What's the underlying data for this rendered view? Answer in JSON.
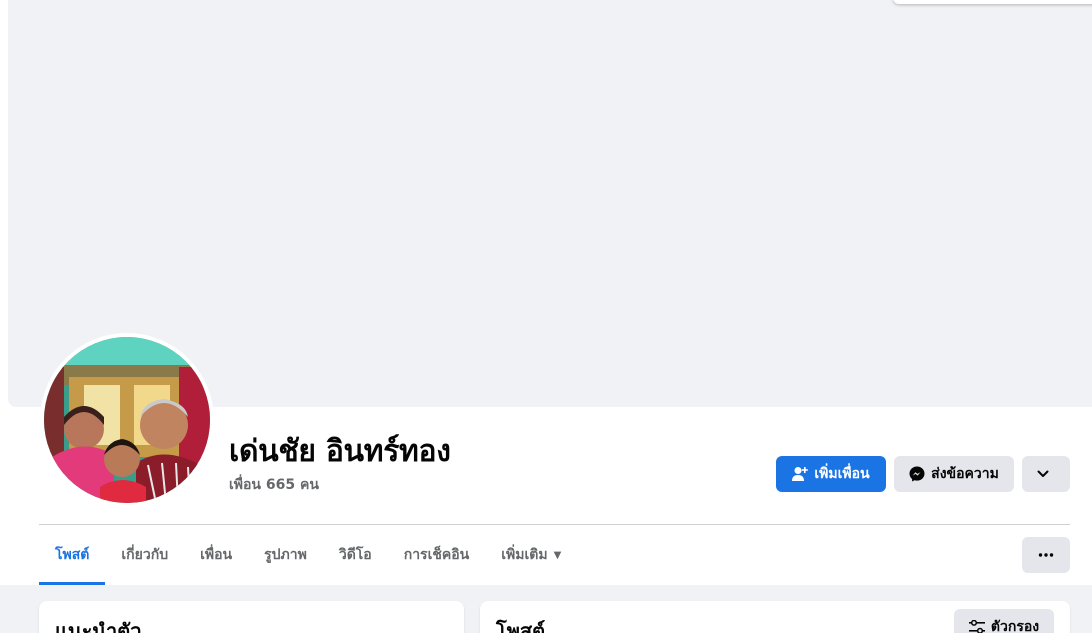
{
  "profile": {
    "name": "เด่นชัย อินทร์ทอง",
    "friends_text": "เพื่อน 665 คน"
  },
  "actions": {
    "add_friend_label": "เพิ่มเพื่อน",
    "message_label": "ส่งข้อความ",
    "more_icon": "chevron-down-icon"
  },
  "tabs": [
    {
      "label": "โพสต์",
      "active": true
    },
    {
      "label": "เกี่ยวกับ",
      "active": false
    },
    {
      "label": "เพื่อน",
      "active": false
    },
    {
      "label": "รูปภาพ",
      "active": false
    },
    {
      "label": "วิดีโอ",
      "active": false
    },
    {
      "label": "การเช็คอิน",
      "active": false
    },
    {
      "label": "เพิ่มเติม",
      "active": false
    }
  ],
  "cards": {
    "intro_title": "แนะนำตัว",
    "posts_title": "โพสต์",
    "filter_label": "ตัวกรอง"
  },
  "colors": {
    "accent": "#1b74e4",
    "secondary_button": "#e4e6eb",
    "page_background": "#f0f2f5"
  }
}
